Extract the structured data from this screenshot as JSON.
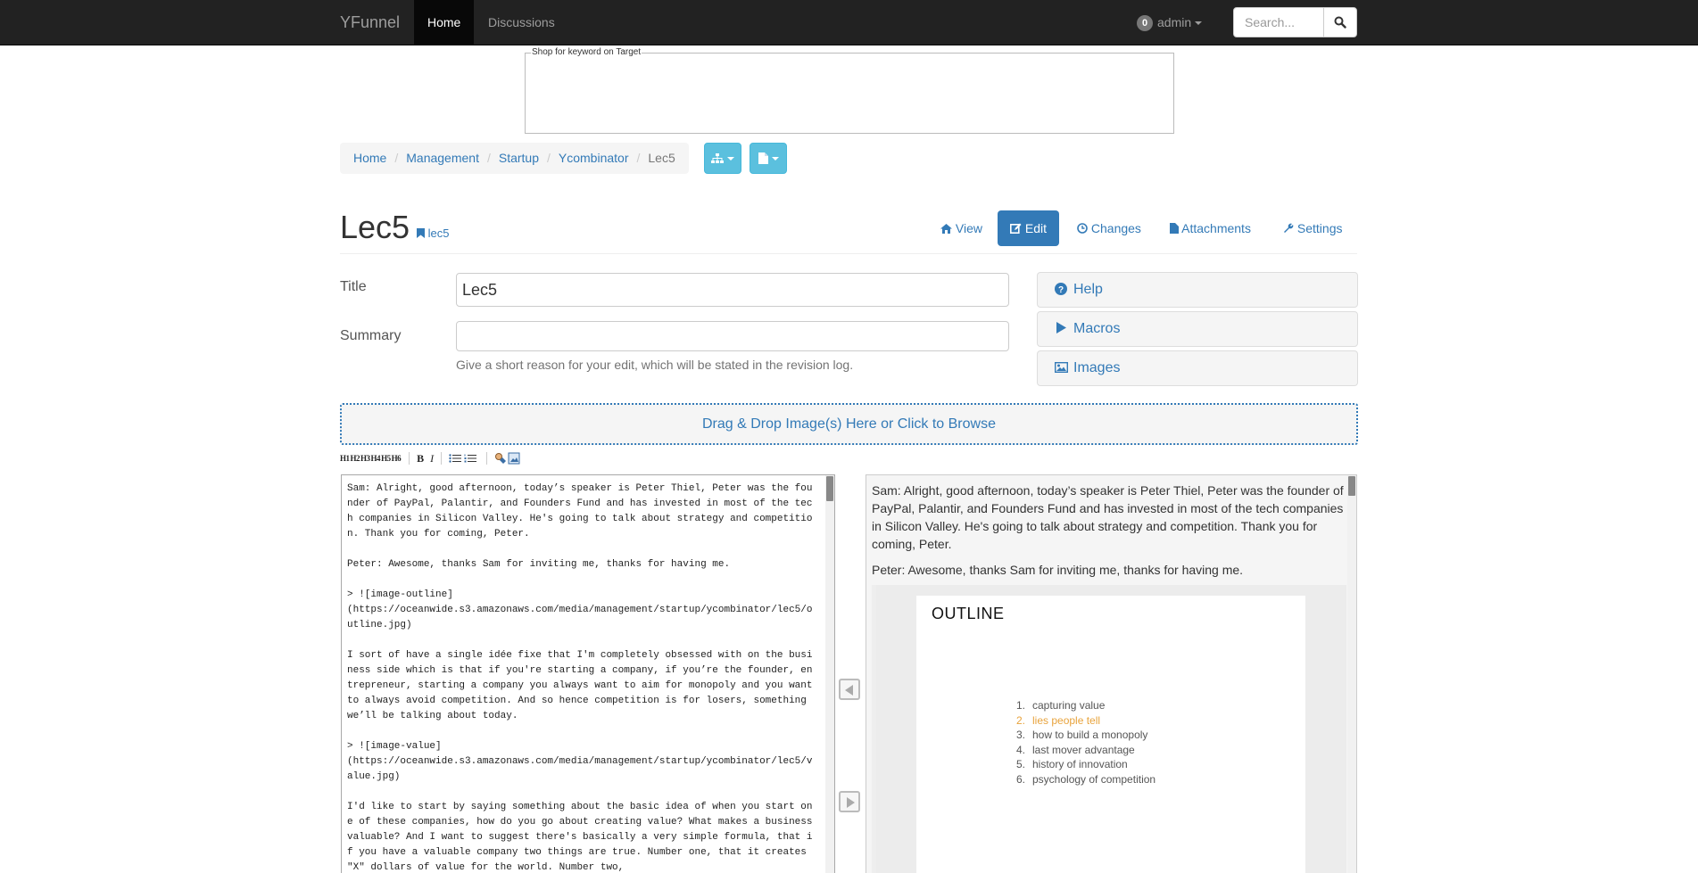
{
  "navbar": {
    "brand": "YFunnel",
    "links": [
      {
        "label": "Home",
        "active": true
      },
      {
        "label": "Discussions",
        "active": false
      }
    ],
    "user": {
      "badge_count": "0",
      "name": "admin"
    },
    "search": {
      "placeholder": "Search...",
      "button_icon": "search-icon"
    }
  },
  "ad": {
    "legend": "Shop for keyword on Target"
  },
  "breadcrumb": {
    "items": [
      "Home",
      "Management",
      "Startup",
      "Ycombinator",
      "Lec5"
    ],
    "tool_buttons": [
      {
        "icon": "sitemap-icon"
      },
      {
        "icon": "file-icon"
      }
    ]
  },
  "page": {
    "title": "Lec5",
    "slug": "lec5",
    "tabs": [
      {
        "label": "View",
        "icon": "home-icon",
        "active": false
      },
      {
        "label": "Edit",
        "icon": "edit-icon",
        "active": true
      },
      {
        "label": "Changes",
        "icon": "clock-icon",
        "active": false
      },
      {
        "label": "Attachments",
        "icon": "file-icon",
        "active": false
      },
      {
        "label": "Settings",
        "icon": "wrench-icon",
        "active": false
      }
    ]
  },
  "form": {
    "title_label": "Title",
    "title_value": "Lec5",
    "summary_label": "Summary",
    "summary_value": "",
    "summary_hint": "Give a short reason for your edit, which will be stated in the revision log."
  },
  "sidebar_panels": [
    {
      "label": "Help",
      "icon": "question-circle-icon"
    },
    {
      "label": "Macros",
      "icon": "play-icon"
    },
    {
      "label": "Images",
      "icon": "picture-icon"
    }
  ],
  "dropzone": {
    "text": "Drag & Drop Image(s) Here or Click to Browse"
  },
  "toolbar": {
    "headings": [
      "H1",
      "H2",
      "H3",
      "H4",
      "H5",
      "H6"
    ],
    "bold": "B",
    "italic": "I"
  },
  "editor": {
    "content": "Sam: Alright, good afternoon, today’s speaker is Peter Thiel, Peter was the founder of PayPal, Palantir, and Founders Fund and has invested in most of the tech companies in Silicon Valley. He's going to talk about strategy and competition. Thank you for coming, Peter.\n\nPeter: Awesome, thanks Sam for inviting me, thanks for having me.\n\n> ![image-outline]\n(https://oceanwide.s3.amazonaws.com/media/management/startup/ycombinator/lec5/outline.jpg)\n\nI sort of have a single idée fixe that I'm completely obsessed with on the business side which is that if you're starting a company, if you’re the founder, entrepreneur, starting a company you always want to aim for monopoly and you want to always avoid competition. And so hence competition is for losers, something we’ll be talking about today.\n\n> ![image-value]\n(https://oceanwide.s3.amazonaws.com/media/management/startup/ycombinator/lec5/value.jpg)\n\nI'd like to start by saying something about the basic idea of when you start one of these companies, how do you go about creating value? What makes a business valuable? And I want to suggest there's basically a very simple formula, that if you have a valuable company two things are true. Number one, that it creates \"X\" dollars of value for the world. Number two,"
  },
  "preview": {
    "para1": "Sam: Alright, good afternoon, today’s speaker is Peter Thiel, Peter was the founder of PayPal, Palantir, and Founders Fund and has invested in most of the tech companies in Silicon Valley. He's going to talk about strategy and competition. Thank you for coming, Peter.",
    "para2": "Peter: Awesome, thanks Sam for inviting me, thanks for having me.",
    "slide": {
      "title": "OUTLINE",
      "items": [
        {
          "num": "1.",
          "text": "capturing value",
          "highlight": false
        },
        {
          "num": "2.",
          "text": "lies people tell",
          "highlight": true
        },
        {
          "num": "3.",
          "text": "how to build a monopoly",
          "highlight": false
        },
        {
          "num": "4.",
          "text": "last mover advantage",
          "highlight": false
        },
        {
          "num": "5.",
          "text": "history of innovation",
          "highlight": false
        },
        {
          "num": "6.",
          "text": "psychology of competition",
          "highlight": false
        }
      ],
      "highlight_color": "#e8a33c"
    }
  },
  "colors": {
    "link": "#337ab7",
    "navbar_bg": "#222222",
    "info_button": "#5bc0de"
  }
}
